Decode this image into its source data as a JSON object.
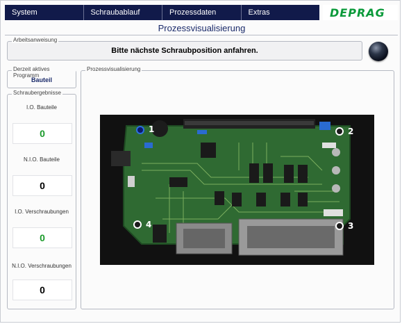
{
  "menu": {
    "items": [
      "System",
      "Schraubablauf",
      "Prozessdaten",
      "Extras"
    ]
  },
  "brand": {
    "logo_text": "DEPRAG",
    "logo_color": "#0a9a3a"
  },
  "page": {
    "title": "Prozessvisualisierung"
  },
  "instruction": {
    "legend": "Arbeitsanweisung",
    "text": "Bitte nächste Schraubposition anfahren."
  },
  "program": {
    "legend": "Derzeit aktives Programm",
    "value": "Bauteil"
  },
  "results": {
    "legend": "Schraubergebnisse",
    "items": [
      {
        "label": "I.O. Bauteile",
        "value": "0",
        "color": "green"
      },
      {
        "label": "N.I.O. Bauteile",
        "value": "0",
        "color": "black"
      },
      {
        "label": "I.O. Verschraubungen",
        "value": "0",
        "color": "green"
      },
      {
        "label": "N.I.O. Verschraubungen",
        "value": "0",
        "color": "black"
      }
    ]
  },
  "visualization": {
    "legend": "Prozessvisualisierung",
    "markers": [
      {
        "number": "1",
        "state": "active"
      },
      {
        "number": "2",
        "state": "inactive"
      },
      {
        "number": "3",
        "state": "inactive"
      },
      {
        "number": "4",
        "state": "inactive"
      }
    ]
  },
  "colors": {
    "menu_bg": "#111a4a",
    "title": "#1a2a6a",
    "ok": "#1a9a2a",
    "pcb": "#2f6a32"
  }
}
